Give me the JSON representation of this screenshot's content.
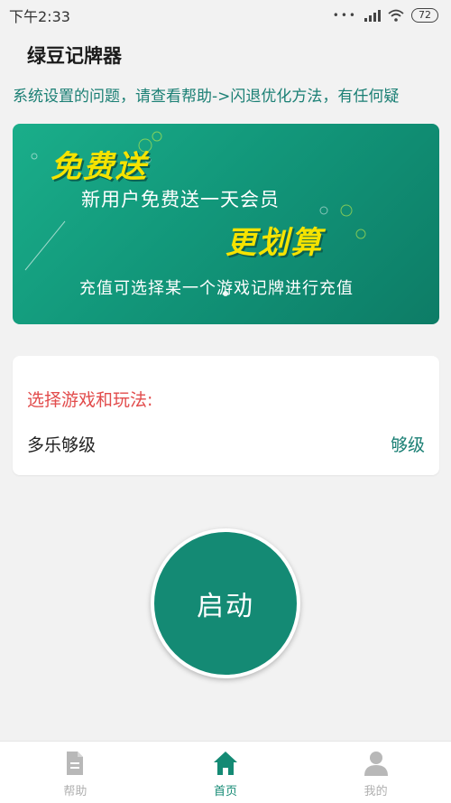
{
  "status_bar": {
    "time": "下午2:33",
    "battery": "72",
    "icons": [
      "dots-icon",
      "signal-icon",
      "wifi-icon",
      "battery-icon"
    ]
  },
  "app": {
    "title": "绿豆记牌器"
  },
  "notice": {
    "text": "系统设置的问题，请查看帮助->闪退优化方法，有任何疑"
  },
  "banner": {
    "headline_1": "免费送",
    "line_1": "新用户免费送一天会员",
    "headline_2": "更划算",
    "line_2": "充值可选择某一个游戏记牌进行充值"
  },
  "game_selection": {
    "label": "选择游戏和玩法:",
    "game": "多乐够级",
    "mode": "够级"
  },
  "start_button": {
    "label": "启动"
  },
  "bottom_nav": {
    "items": [
      {
        "label": "帮助",
        "icon": "document-icon",
        "active": false
      },
      {
        "label": "首页",
        "icon": "home-icon",
        "active": true
      },
      {
        "label": "我的",
        "icon": "user-icon",
        "active": false
      }
    ]
  },
  "colors": {
    "accent": "#148a74",
    "label_red": "#e24c4c",
    "banner_yellow": "#f5e300"
  }
}
